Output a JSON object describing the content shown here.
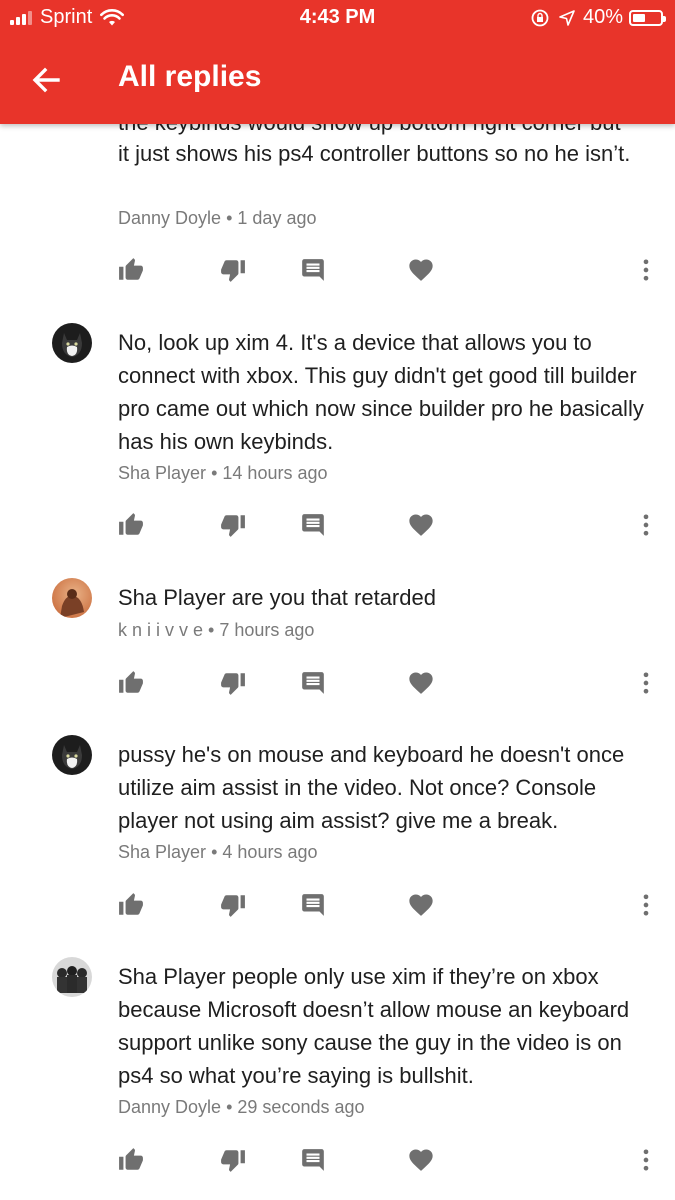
{
  "status": {
    "carrier": "Sprint",
    "time": "4:43 PM",
    "battery": "40%"
  },
  "header": {
    "title": "All replies"
  },
  "colors": {
    "accent": "#e8342a",
    "text": "#1f1f1f",
    "meta": "#7a7a7a",
    "icon": "#6f6f6f"
  },
  "comments": [
    {
      "text_partial_top": "the keybinds would show up bottom right corner but",
      "text": "it just shows his ps4 controller buttons so no he isn’t.",
      "author": "Danny Doyle",
      "time": "1 day ago"
    },
    {
      "text": "No, look up xim 4. It's a device that allows you to connect with xbox. This guy didn't get good till builder pro came out which now since builder pro he basically has his own keybinds.",
      "author": "Sha Player",
      "time": "14 hours ago"
    },
    {
      "text": "Sha Player are you that retarded",
      "author": "k n i i v v e",
      "time": "7 hours ago"
    },
    {
      "text": "pussy he's on mouse and keyboard he doesn't once utilize aim assist in the video. Not once? Console player not using aim assist? give me a break.",
      "author": "Sha Player",
      "time": "4 hours ago"
    },
    {
      "text": "Sha Player people only use xim if they’re on xbox because Microsoft doesn’t allow mouse an keyboard support unlike sony cause the guy in the video is on ps4 so what you’re saying is bullshit.",
      "author": "Danny Doyle",
      "time": "29 seconds ago"
    }
  ],
  "meta_separator": "•",
  "icons": [
    "back-arrow-icon",
    "thumb-up-icon",
    "thumb-down-icon",
    "reply-icon",
    "heart-icon",
    "more-vert-icon",
    "wifi-icon",
    "location-arrow-icon",
    "rotation-lock-icon"
  ]
}
